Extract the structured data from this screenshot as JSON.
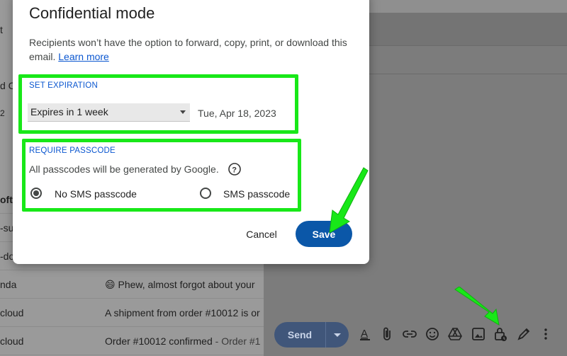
{
  "background": {
    "frag_left_1": "t",
    "frag_left_2": "d C",
    "frag_left_3": "2",
    "rows": [
      {
        "from": "oft",
        "subject": "",
        "bold": true
      },
      {
        "from": "-su",
        "subject": ""
      },
      {
        "from": "-do",
        "subject": ""
      },
      {
        "from": "nda",
        "subject": "😄 Phew, almost forgot about your",
        "muted": ""
      },
      {
        "from": "cloud",
        "subject": "A shipment from order #10012 is or",
        "muted": ""
      },
      {
        "from": "cloud",
        "subject": "Order #10012 confirmed",
        "muted": " - Order #1"
      }
    ]
  },
  "compose": {
    "send_label": "Send",
    "toolbar_icons": [
      "format-text-icon",
      "attach-icon",
      "link-icon",
      "emoji-icon",
      "drive-icon",
      "photo-icon",
      "confidential-lock-icon",
      "signature-pen-icon",
      "more-options-icon"
    ]
  },
  "dialog": {
    "title": "Confidential mode",
    "description": "Recipients won’t have the option to forward, copy, print, or download this email.",
    "learn_more": "Learn more",
    "expiration": {
      "label": "SET EXPIRATION",
      "selected": "Expires in 1 week",
      "date": "Tue, Apr 18, 2023"
    },
    "passcode": {
      "label": "REQUIRE PASSCODE",
      "note": "All passcodes will be generated by Google.",
      "options": [
        {
          "label": "No SMS passcode",
          "selected": true
        },
        {
          "label": "SMS passcode",
          "selected": false
        }
      ]
    },
    "cancel_label": "Cancel",
    "save_label": "Save"
  },
  "colors": {
    "accent": "#0b57a8",
    "highlight": "#18e818",
    "link": "#0b57d0"
  }
}
